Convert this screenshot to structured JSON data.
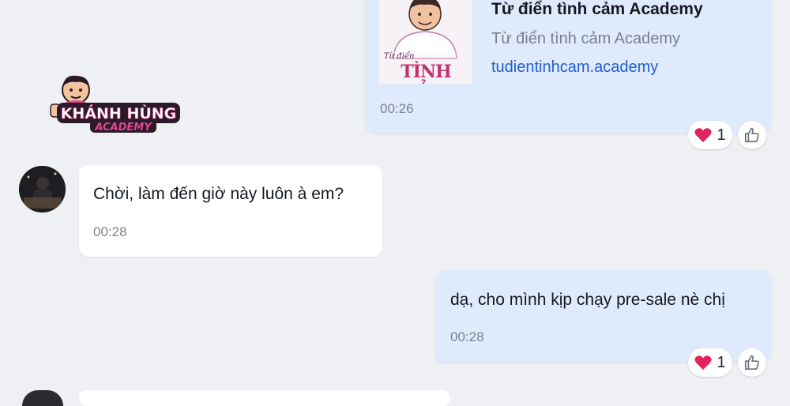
{
  "watermark": {
    "logo_text_line1": "KHÁNH HÙNG",
    "logo_text_line2": "ACADEMY"
  },
  "link_preview": {
    "thumbnail_text_small": "Từ điển",
    "thumbnail_text_big": "TÌNH CẢM",
    "title": "Từ điển tình cảm Academy",
    "subtitle": "Từ điển tình cảm Academy",
    "url": "tudientinhcam.academy",
    "time": "00:26",
    "reaction": {
      "icon": "heart-icon",
      "count": "1"
    }
  },
  "incoming_message": {
    "text": "Chời, làm đến giờ này luôn à em?",
    "time": "00:28"
  },
  "outgoing_message": {
    "text": "dạ, cho mình kịp chạy pre-sale nè chị",
    "time": "00:28",
    "reaction": {
      "icon": "heart-icon",
      "count": "1"
    }
  },
  "colors": {
    "background": "#eef0f3",
    "outgoing_bubble": "#dfeafc",
    "incoming_bubble": "#ffffff",
    "link": "#1f5fcf",
    "heart": "#e0245e",
    "logo_pink": "#e2458f"
  }
}
